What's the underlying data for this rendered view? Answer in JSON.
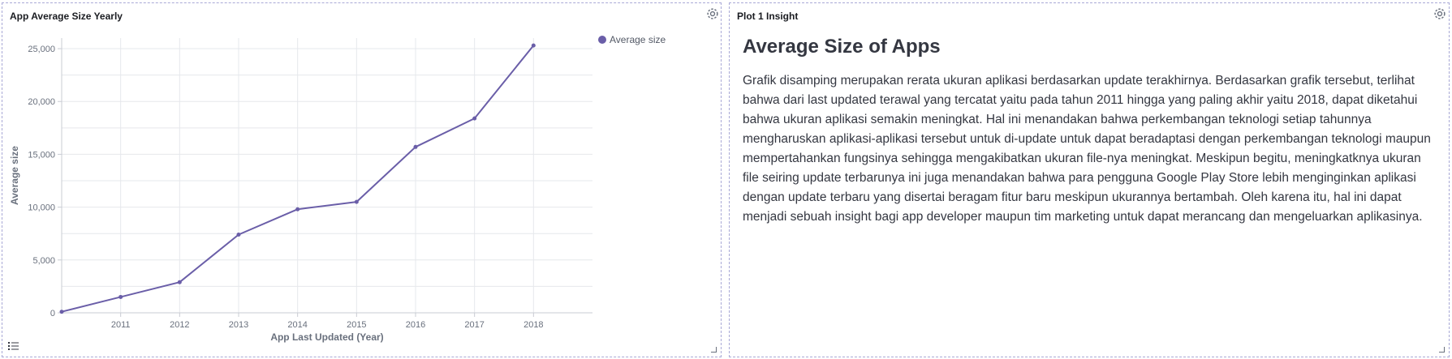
{
  "panels": {
    "chart_panel": {
      "title": "App Average Size Yearly"
    },
    "insight_panel": {
      "title": "Plot 1 Insight",
      "heading": "Average Size of Apps",
      "body": "Grafik disamping merupakan rerata ukuran aplikasi berdasarkan update terakhirnya. Berdasarkan grafik tersebut, terlihat bahwa dari last updated terawal yang tercatat yaitu pada tahun 2011 hingga yang paling akhir yaitu 2018, dapat diketahui bahwa ukuran aplikasi semakin meningkat. Hal ini menandakan bahwa perkembangan teknologi setiap tahunnya mengharuskan aplikasi-aplikasi tersebut untuk di-update untuk dapat beradaptasi dengan perkembangan teknologi maupun mempertahankan fungsinya sehingga mengakibatkan ukuran file-nya meningkat. Meskipun begitu, meningkatknya ukuran file seiring update terbarunya ini juga menandakan bahwa para pengguna Google Play Store lebih menginginkan aplikasi dengan update terbaru yang disertai beragam fitur baru meskipun ukurannya bertambah. Oleh karena itu, hal ini dapat menjadi sebuah insight bagi app developer maupun tim marketing untuk dapat merancang dan mengeluarkan aplikasinya."
    }
  },
  "icons": {
    "gear": "gear-icon",
    "legend_toggle": "list-icon"
  },
  "colors": {
    "series": "#6a5ea8",
    "grid": "#e6e8ec",
    "border": "#a9a9d6"
  },
  "chart_data": {
    "type": "line",
    "xlabel": "App Last Updated (Year)",
    "ylabel": "Average size",
    "xlim": [
      2010,
      2019
    ],
    "ylim": [
      0,
      26000
    ],
    "x_ticks": [
      "2011",
      "2012",
      "2013",
      "2014",
      "2015",
      "2016",
      "2017",
      "2018"
    ],
    "y_ticks": [
      "0",
      "5,000",
      "10,000",
      "15,000",
      "20,000",
      "25,000"
    ],
    "grid": true,
    "legend_position": "top-right",
    "series": [
      {
        "name": "Average size",
        "x": [
          2010,
          2011,
          2012,
          2013,
          2014,
          2015,
          2016,
          2017,
          2018
        ],
        "values": [
          100,
          1500,
          2900,
          7400,
          9800,
          10500,
          15700,
          18400,
          25300
        ]
      }
    ]
  }
}
